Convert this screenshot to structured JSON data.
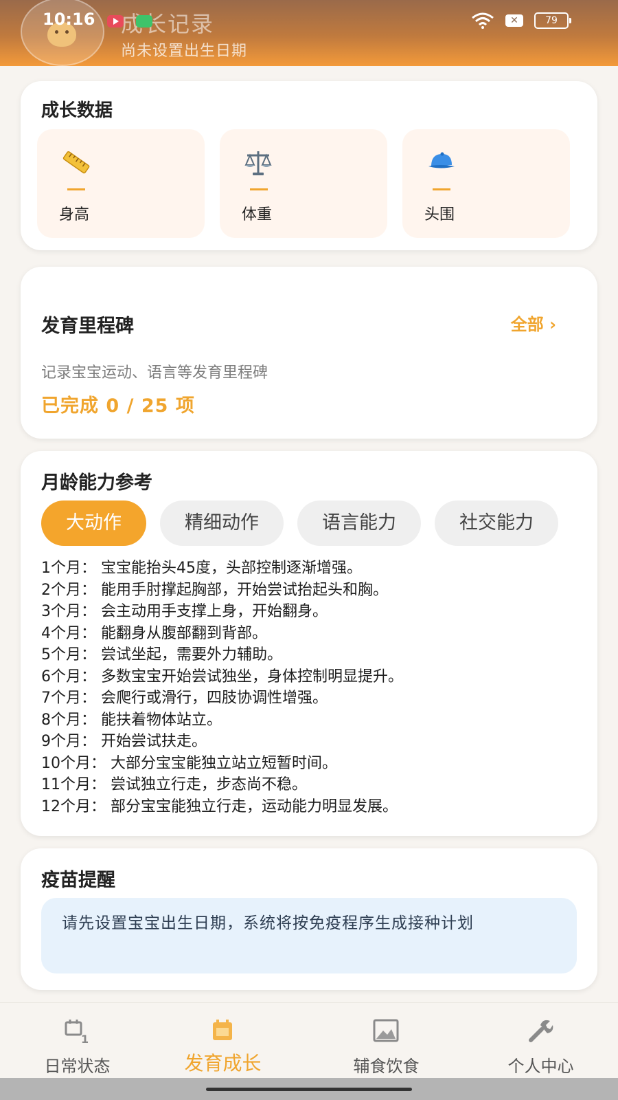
{
  "status_bar": {
    "time": "10:16",
    "battery": "79"
  },
  "header": {
    "title": "成长记录",
    "subtitle": "尚未设置出生日期"
  },
  "growth_data": {
    "title": "成长数据",
    "items": [
      {
        "label": "身高",
        "value": "—",
        "icon": "ruler-icon"
      },
      {
        "label": "体重",
        "value": "—",
        "icon": "scale-icon"
      },
      {
        "label": "头围",
        "value": "—",
        "icon": "cap-icon"
      }
    ]
  },
  "milestones": {
    "title": "发育里程碑",
    "all_link": "全部 ›",
    "description": "记录宝宝运动、语言等发育里程碑",
    "progress": "已完成 0 / 25 项"
  },
  "abilities": {
    "title": "月龄能力参考",
    "tabs": [
      "大动作",
      "精细动作",
      "语言能力",
      "社交能力"
    ],
    "selected_tab": "大动作",
    "items": [
      "1个月： 宝宝能抬头45度，头部控制逐渐增强。",
      "2个月： 能用手肘撑起胸部，开始尝试抬起头和胸。",
      "3个月： 会主动用手支撑上身，开始翻身。",
      "4个月： 能翻身从腹部翻到背部。",
      "5个月： 尝试坐起，需要外力辅助。",
      "6个月： 多数宝宝开始尝试独坐，身体控制明显提升。",
      "7个月： 会爬行或滑行，四肢协调性增强。",
      "8个月： 能扶着物体站立。",
      "9个月： 开始尝试扶走。",
      "10个月： 大部分宝宝能独立站立短暂时间。",
      "11个月： 尝试独立行走，步态尚不稳。",
      "12个月： 部分宝宝能独立行走，运动能力明显发展。"
    ]
  },
  "vaccine": {
    "title": "疫苗提醒",
    "message": "请先设置宝宝出生日期，系统将按免疫程序生成接种计划"
  },
  "bottom_nav": {
    "items": [
      {
        "label": "日常状态",
        "icon": "calendar-icon"
      },
      {
        "label": "发育成长",
        "icon": "growth-icon"
      },
      {
        "label": "辅食饮食",
        "icon": "image-icon"
      },
      {
        "label": "个人中心",
        "icon": "wrench-icon"
      }
    ],
    "active": "发育成长"
  },
  "colors": {
    "accent": "#f0a52e",
    "header_gradient_end": "#f39a3a",
    "tile_background": "#fff5ee",
    "vaccine_background": "#e7f2fc"
  }
}
